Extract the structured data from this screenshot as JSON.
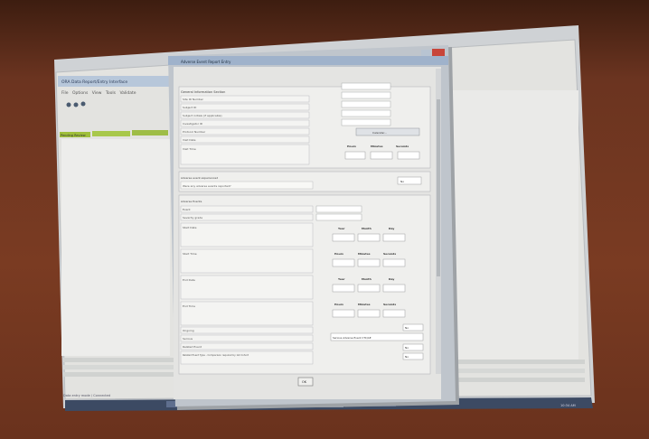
{
  "main_window": {
    "title": "ORA Data Report/Entry Interface",
    "menu": [
      "File",
      "Options",
      "View",
      "Tools",
      "Validate",
      "Help",
      "Reports"
    ],
    "tabs": [
      "Pending Review",
      "Submitted Reports",
      "Archive"
    ],
    "tree_item": "Project Reports",
    "status_bar": "Data entry mode / Connected"
  },
  "dialog": {
    "title": "Adverse Event Report Entry",
    "section_header": "General Information Section",
    "left_fields": [
      "Site ID Number",
      "Subject ID",
      "Subject initials (if applicable)",
      "Investigator ID",
      "Protocol Number",
      "Visit Date",
      "Visit Time"
    ],
    "time_headers": [
      "Hours",
      "Minutes",
      "Seconds"
    ],
    "choose_button": "Calendar...",
    "question_section": "Adverse event experienced",
    "question_text": "Were any adverse events reported?",
    "question_value": "No",
    "event_section": "Adverse Events",
    "event_fields": [
      "Event",
      "Severity grade",
      "Start Date",
      "Start Time",
      "End Date",
      "End Time",
      "Ongoing",
      "Serious",
      "Related Event",
      "Related Event Type - Comparison required by 1st Cohort"
    ],
    "date_headers": [
      "Year",
      "Month",
      "Day"
    ],
    "serious_value": "Serious Adverse Event CTC/AE",
    "yes_no": [
      "No",
      "No",
      "No",
      "No"
    ],
    "ok_button": "OK"
  },
  "taskbar": {
    "items": [
      "Start",
      "ORA Data",
      "Reports",
      "Entry"
    ],
    "clock": "10:34 AM"
  }
}
